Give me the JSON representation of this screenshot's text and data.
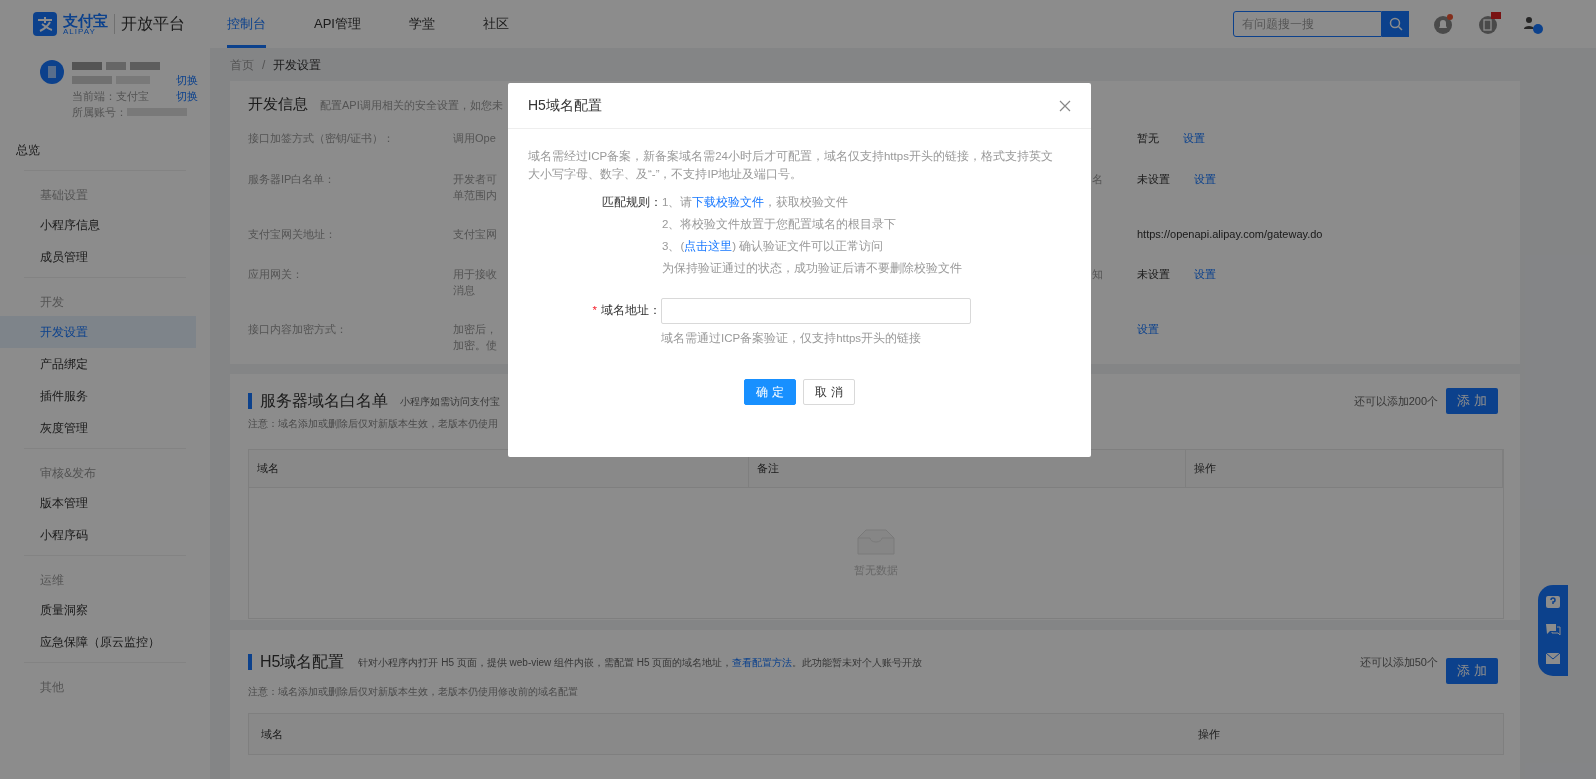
{
  "header": {
    "brand": "支付宝",
    "brand_sub": "ALIPAY",
    "platform": "开放平台",
    "nav": [
      {
        "label": "控制台",
        "selected": true
      },
      {
        "label": "API管理",
        "selected": false
      },
      {
        "label": "学堂",
        "selected": false
      },
      {
        "label": "社区",
        "selected": false
      }
    ],
    "search": {
      "placeholder": "有问题搜一搜"
    }
  },
  "sidebar": {
    "account": {
      "switch_links": [
        "切换",
        "切换"
      ],
      "client_label": "当前端：支付宝",
      "account_label": "所属账号："
    },
    "groups": [
      {
        "items": [
          {
            "label": "总览",
            "selected": false
          }
        ]
      },
      {
        "title": "基础设置",
        "items": [
          {
            "label": "小程序信息",
            "selected": false
          },
          {
            "label": "成员管理",
            "selected": false
          }
        ]
      },
      {
        "title": "开发",
        "items": [
          {
            "label": "开发设置",
            "selected": true
          },
          {
            "label": "产品绑定",
            "selected": false
          },
          {
            "label": "插件服务",
            "selected": false
          },
          {
            "label": "灰度管理",
            "selected": false
          }
        ]
      },
      {
        "title": "审核&发布",
        "items": [
          {
            "label": "版本管理",
            "selected": false
          },
          {
            "label": "小程序码",
            "selected": false
          }
        ]
      },
      {
        "title": "运维",
        "items": [
          {
            "label": "质量洞察",
            "selected": false
          },
          {
            "label": "应急保障（原云监控）",
            "selected": false
          }
        ]
      },
      {
        "title": "其他"
      }
    ]
  },
  "breadcrumb": [
    "首页",
    "开发设置"
  ],
  "breadcrumb_separator": "/",
  "dev_info": {
    "title": "开发信息",
    "description": "配置API调用相关的安全设置，如您未",
    "rows": [
      {
        "label": "接口加签方式（密钥/证书）：",
        "value_lines": [
          "调用Ope"
        ],
        "right_value": "暂无",
        "right_link": "设置"
      },
      {
        "label": "服务器IP白名单：",
        "value_lines": [
          "开发者可",
          "单范围内"
        ],
        "right_label": "名",
        "right_value": "未设置",
        "right_link": "设置"
      },
      {
        "label": "支付宝网关地址：",
        "value_lines": [
          "支付宝网"
        ],
        "right_value": "https://openapi.alipay.com/gateway.do"
      },
      {
        "label": "应用网关：",
        "value_lines": [
          "用于接收",
          "消息"
        ],
        "right_label": "知",
        "right_value": "未设置",
        "right_link": "设置"
      },
      {
        "label": "接口内容加密方式：",
        "value_lines": [
          "加密后，",
          "加密。使"
        ],
        "right_link": "设置"
      }
    ]
  },
  "server_whitelist": {
    "title": "服务器域名白名单",
    "description": "小程序如需访问支付宝",
    "note": "注意：域名添加或删除后仅对新版本生效，老版本仍使用",
    "quota": "还可以添加200个",
    "add_button": "添 加",
    "columns": [
      "域名",
      "备注",
      "操作"
    ],
    "empty_text": "暂无数据"
  },
  "h5_domains": {
    "title": "H5域名配置",
    "description_before": "针对小程序内打开 H5 页面，提供 web-view 组件内嵌，需配置 H5 页面的域名地址，",
    "description_link": "查看配置方法",
    "description_after": "。此功能暂未对个人账号开放",
    "note": "注意：域名添加或删除后仅对新版本生效，老版本仍使用修改前的域名配置",
    "quota": "还可以添加50个",
    "add_button": "添 加",
    "columns": [
      "域名",
      "操作"
    ]
  },
  "modal": {
    "title": "H5域名配置",
    "intro": "域名需经过ICP备案，新备案域名需24小时后才可配置，域名仅支持https开头的链接，格式支持英文大小写字母、数字、及“-”，不支持IP地址及端口号。",
    "rules_label": "匹配规则：",
    "rules": [
      {
        "before": "1、请",
        "link": "下载校验文件",
        "after": "，获取校验文件"
      },
      {
        "before": "2、将校验文件放置于您配置域名的根目录下"
      },
      {
        "before": "3、(",
        "link": "点击这里",
        "after": ") 确认验证文件可以正常访问"
      },
      {
        "before": "为保持验证通过的状态，成功验证后请不要删除校验文件"
      }
    ],
    "field": {
      "label": "域名地址：",
      "required_mark": "*",
      "hint": "域名需通过ICP备案验证，仅支持https开头的链接"
    },
    "buttons": [
      {
        "label": "确 定",
        "kind": "primary"
      },
      {
        "label": "取 消",
        "kind": "default"
      }
    ]
  }
}
